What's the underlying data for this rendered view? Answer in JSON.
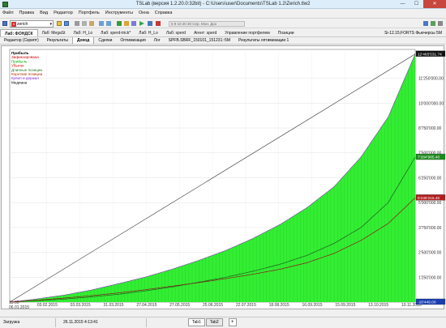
{
  "window": {
    "title": "TSLab (версия 1.2.20.0:32bit) - C:\\Users\\user\\Documents\\TSLab 1.2\\Zerich.tlw2",
    "minimize": "—",
    "maximize": "☐",
    "close": "✕"
  },
  "menu": [
    "Файл",
    "Правка",
    "Вид",
    "Редактор",
    "Портфель",
    "Инструменты",
    "Окна",
    "Справка"
  ],
  "toolbar": {
    "script_name": "zerich",
    "params_text": "5   9   10   20   30     Сер. Мон. Дох"
  },
  "lab_tabs": {
    "items": [
      "Лаб: ФОНДСК",
      "Лаб: MegaSt",
      "Лаб: H_Lo",
      "Лаб: sperd-trick*",
      "Лаб: H_Lo",
      "Лаб: sperd",
      "Агент: sperd",
      "Управление портфелем",
      "Позиции"
    ],
    "active_index": 0,
    "status": "Si-12.15;FORTS Фьючерсы 5M"
  },
  "sub_tabs": {
    "items": [
      "Редактор (Скрипт)",
      "Результаты",
      "Доход",
      "Сделки",
      "Оптимизация",
      "Лог",
      "SPFB.SBRF_150101_151231::5M",
      "Результаты оптимизации 1"
    ],
    "active_index": 2
  },
  "chart_data": {
    "type": "area",
    "x_labels": [
      "15:00\n06.01.2015",
      "03.02.2015",
      "03.03.2015",
      "31.03.2015",
      "27.04.2015",
      "27.05.2015",
      "25.06.2015",
      "22.07.2015",
      "18.08.2015",
      "16.09.2015",
      "15.09.2015",
      "13.10.2015",
      "10.11.2015"
    ],
    "y_ticks": [
      "1'250'000.00",
      "2'500'000.00",
      "3'750'000.00",
      "5'000'000.00",
      "6'250'000.00",
      "7'500'000.00",
      "8'750'000.00",
      "10'000'000.00",
      "11'250'000.00"
    ],
    "ylim": [
      0,
      12700000
    ],
    "badges": {
      "top": "12'465'531.74",
      "green": "7'284'985.40",
      "red": "5'236'215.40",
      "bottom": "-16'449.00"
    },
    "legend": [
      {
        "label": "Прибыль",
        "color": "#000000"
      },
      {
        "label": "Зафиксирована",
        "color": "#cc0000"
      },
      {
        "label": "Прибыль",
        "color": "#00aa00"
      },
      {
        "label": "Убыток",
        "color": "#d40000"
      },
      {
        "label": "Длинные позиции",
        "color": "#2a7a2a"
      },
      {
        "label": "Короткие позиции",
        "color": "#b03000"
      },
      {
        "label": "Купил и держал",
        "color": "#8a2be2"
      },
      {
        "label": "Медиана",
        "color": "#000000"
      }
    ],
    "series": [
      {
        "name": "Прибыль",
        "values": [
          0,
          160000,
          350000,
          600000,
          920000,
          1250000,
          1650000,
          2100000,
          2600000,
          3200000,
          3900000,
          4750000,
          5800000,
          7300000,
          9300000,
          12465531
        ]
      },
      {
        "name": "Длинные позиции",
        "values": [
          0,
          70000,
          150000,
          260000,
          390000,
          560000,
          760000,
          1000000,
          1250000,
          1550000,
          1900000,
          2350000,
          2950000,
          3750000,
          5000000,
          7284985
        ]
      },
      {
        "name": "Короткие позиции",
        "values": [
          0,
          90000,
          200000,
          320000,
          460000,
          620000,
          800000,
          980000,
          1180000,
          1400000,
          1650000,
          1980000,
          2450000,
          3100000,
          3950000,
          5236215
        ]
      },
      {
        "name": "Медиана",
        "values": [
          0,
          12465531
        ]
      }
    ]
  },
  "status": {
    "state": "Загрузка",
    "datetime": "26.11.2015 4:13:41"
  },
  "bottom_tabs": {
    "items": [
      "Tab1",
      "Tab2"
    ],
    "active_index": 0,
    "add": "+"
  }
}
